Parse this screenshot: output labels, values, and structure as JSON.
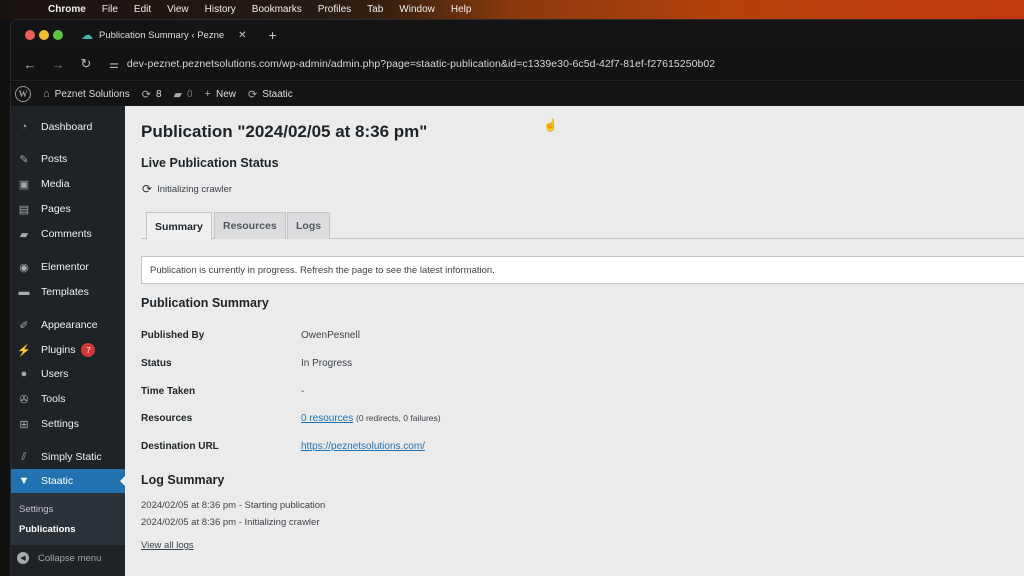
{
  "macos_menu": {
    "app": "Chrome",
    "items": [
      "File",
      "Edit",
      "View",
      "History",
      "Bookmarks",
      "Profiles",
      "Tab",
      "Window",
      "Help"
    ]
  },
  "browser": {
    "tab_title": "Publication Summary ‹ Pezne",
    "url": "dev-peznet.peznetsolutions.com/wp-admin/admin.php?page=staatic-publication&id=c1339e30-6c5d-42f7-81ef-f27615250b02"
  },
  "adminbar": {
    "site_name": "Peznet Solutions",
    "updates_count": "8",
    "comments_count": "0",
    "new_label": "New",
    "staatic_label": "Staatic"
  },
  "sidebar": {
    "items": [
      {
        "label": "Dashboard",
        "icon": "dashboard-icon"
      },
      {
        "label": "Posts",
        "icon": "pin-icon"
      },
      {
        "label": "Media",
        "icon": "media-icon"
      },
      {
        "label": "Pages",
        "icon": "pages-icon"
      },
      {
        "label": "Comments",
        "icon": "comment-icon"
      },
      {
        "label": "Elementor",
        "icon": "elementor-icon"
      },
      {
        "label": "Templates",
        "icon": "folder-icon"
      },
      {
        "label": "Appearance",
        "icon": "brush-icon"
      },
      {
        "label": "Plugins",
        "icon": "plugin-icon",
        "badge": "7"
      },
      {
        "label": "Users",
        "icon": "user-icon"
      },
      {
        "label": "Tools",
        "icon": "wrench-icon"
      },
      {
        "label": "Settings",
        "icon": "settings-icon"
      },
      {
        "label": "Simply Static",
        "icon": "simply-static-icon"
      },
      {
        "label": "Staatic",
        "icon": "staatic-icon",
        "current": true
      }
    ],
    "submenu": [
      {
        "label": "Settings"
      },
      {
        "label": "Publications",
        "active": true
      }
    ],
    "collapse_label": "Collapse menu"
  },
  "main": {
    "title": "Publication \"2024/02/05 at 8:36 pm\"",
    "live_status_heading": "Live Publication Status",
    "live_status_text": "Initializing crawler",
    "tabs": [
      {
        "label": "Summary",
        "active": true
      },
      {
        "label": "Resources"
      },
      {
        "label": "Logs"
      }
    ],
    "notice": "Publication is currently in progress. Refresh the page to see the latest information.",
    "summary_heading": "Publication Summary",
    "summary_rows": [
      {
        "label": "Published By",
        "value": "OwenPesnell"
      },
      {
        "label": "Status",
        "value": "In Progress"
      },
      {
        "label": "Time Taken",
        "value": "-"
      },
      {
        "label": "Resources",
        "link": "0 resources",
        "extra": "(0 redirects, 0 failures)"
      },
      {
        "label": "Destination URL",
        "link": "https://peznetsolutions.com/"
      }
    ],
    "log_heading": "Log Summary",
    "log_lines": [
      "2024/02/05 at 8:36 pm - Starting publication",
      "2024/02/05 at 8:36 pm - Initializing crawler"
    ],
    "view_logs_label": "View all logs"
  },
  "colors": {
    "accent": "#2271b1",
    "sidebar_bg": "#1d2327",
    "badge": "#d63638",
    "content_bg": "#ebebeb"
  }
}
